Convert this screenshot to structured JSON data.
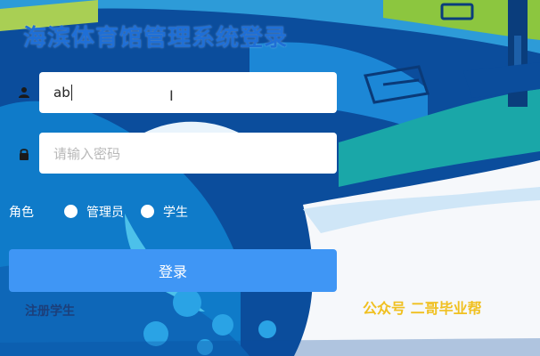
{
  "title": "海滨体育馆管理系统登录",
  "username": {
    "value": "ab"
  },
  "password": {
    "value": "",
    "placeholder": "请输入密码"
  },
  "role": {
    "label": "角色",
    "options": [
      "管理员",
      "学生"
    ]
  },
  "login_button": "登录",
  "register_link": "注册学生",
  "watermark": "公众号 二哥毕业帮",
  "icons": {
    "username": "user-icon",
    "password": "lock-icon"
  },
  "colors": {
    "primary_button": "#3f96f5",
    "title": "#1f6fd6",
    "watermark": "#f0c020",
    "register": "#1c3f7a"
  }
}
